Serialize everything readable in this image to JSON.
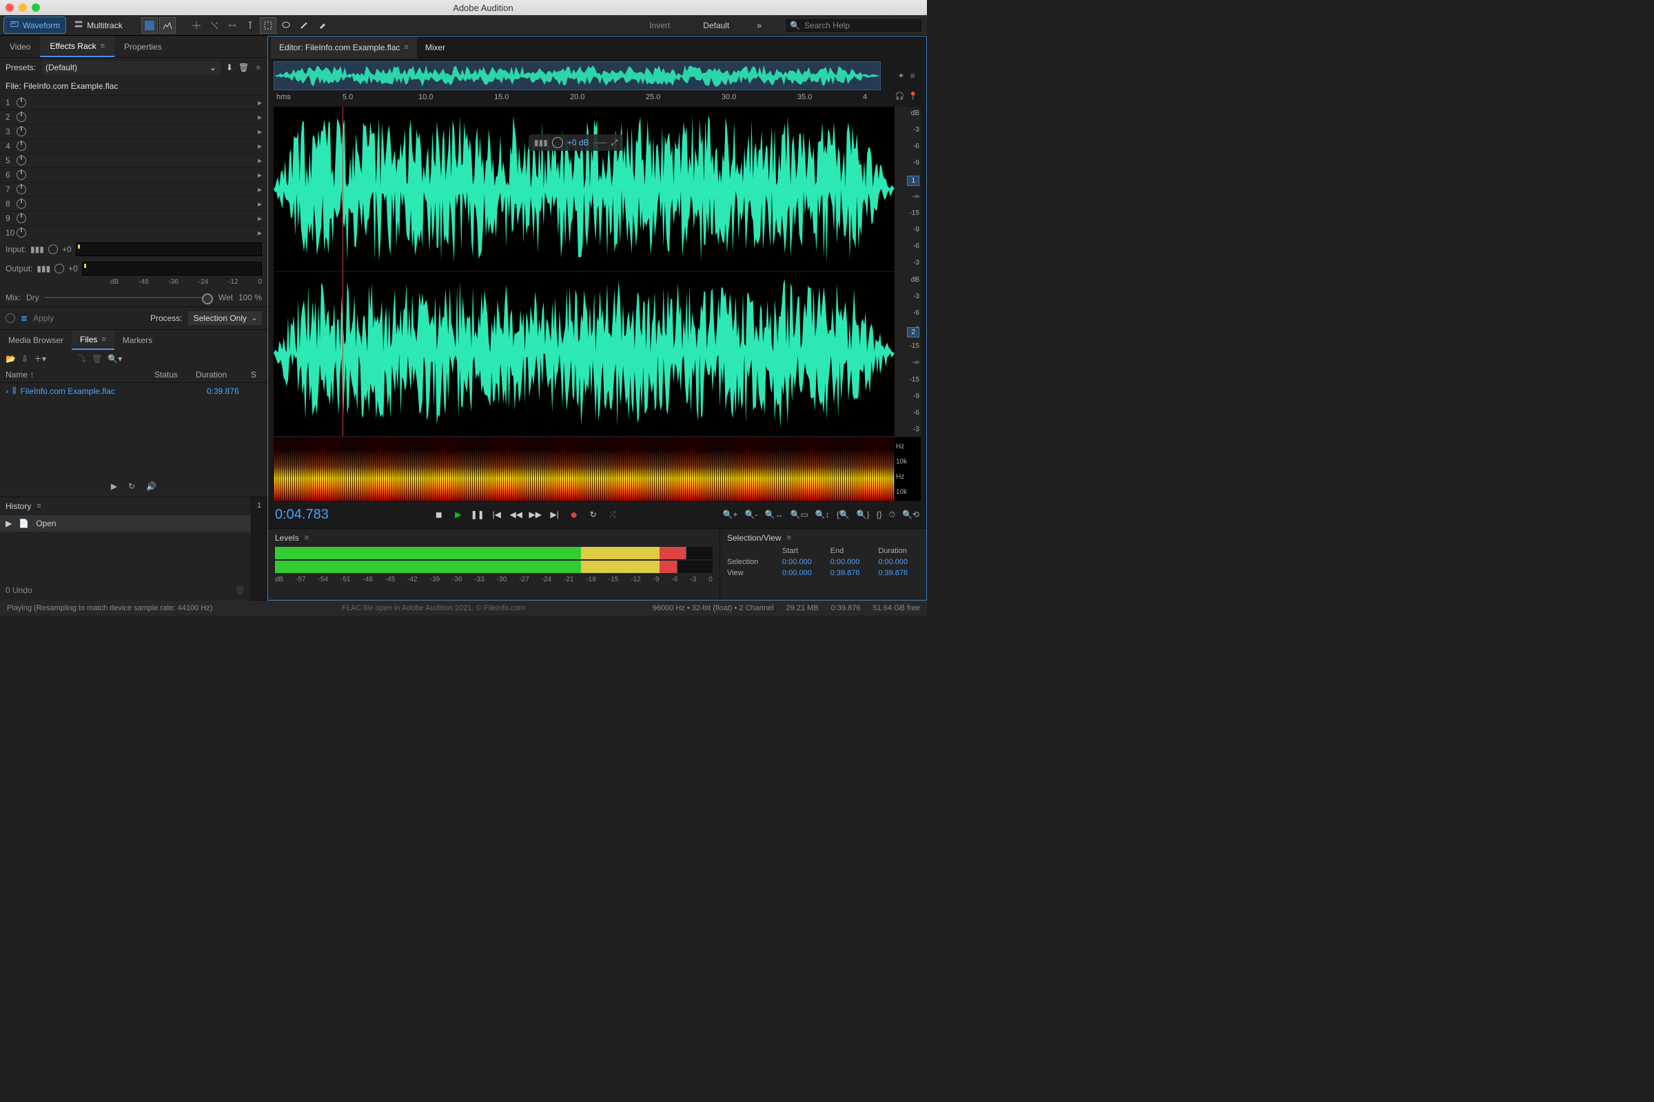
{
  "app": {
    "title": "Adobe Audition"
  },
  "topbar": {
    "waveform": "Waveform",
    "multitrack": "Multitrack",
    "invert": "Invert",
    "workspace": "Default",
    "search_placeholder": "Search Help"
  },
  "left_tabs": {
    "video": "Video",
    "effects_rack": "Effects Rack",
    "properties": "Properties"
  },
  "effects": {
    "presets_label": "Presets:",
    "preset_value": "(Default)",
    "file_label": "File: FileInfo.com Example.flac",
    "slot_count": "10",
    "input_label": "Input:",
    "output_label": "Output:",
    "io_db": "+0",
    "db_scale": [
      "dB",
      "-48",
      "-36",
      "-24",
      "-12",
      "0"
    ],
    "mix_label": "Mix:",
    "dry": "Dry",
    "wet": "Wet",
    "mix_pct": "100 %",
    "apply": "Apply",
    "process_label": "Process:",
    "process_value": "Selection Only"
  },
  "files_tabs": {
    "media_browser": "Media Browser",
    "files": "Files",
    "markers": "Markers"
  },
  "files": {
    "cols": {
      "name": "Name",
      "status": "Status",
      "duration": "Duration",
      "s": "S"
    },
    "row": {
      "name": "FileInfo.com Example.flac",
      "duration": "0:39.876"
    }
  },
  "history": {
    "title": "History",
    "open": "Open",
    "undo": "0 Undo",
    "badge": "1"
  },
  "editor": {
    "tab_label": "Editor: FileInfo.com Example.flac",
    "mixer": "Mixer",
    "hms": "hms",
    "ticks": [
      "5.0",
      "10.0",
      "15.0",
      "20.0",
      "25.0",
      "30.0",
      "35.0",
      "4"
    ],
    "db_label": "dB",
    "db_marks": [
      "-3",
      "-6",
      "-9",
      "-15",
      "-∞",
      "-15",
      "-9",
      "-6",
      "-3"
    ],
    "ch1": "1",
    "ch2": "2",
    "hz": "Hz",
    "hz10k": "10k",
    "hud_db": "+0 dB",
    "time": "0:04.783"
  },
  "levels": {
    "title": "Levels",
    "scale": [
      "dB",
      "-57",
      "-54",
      "-51",
      "-48",
      "-45",
      "-42",
      "-39",
      "-36",
      "-33",
      "-30",
      "-27",
      "-24",
      "-21",
      "-18",
      "-15",
      "-12",
      "-9",
      "-6",
      "-3",
      "0"
    ]
  },
  "selview": {
    "title": "Selection/View",
    "cols": [
      "Start",
      "End",
      "Duration"
    ],
    "rows": {
      "selection": {
        "label": "Selection",
        "start": "0:00.000",
        "end": "0:00.000",
        "dur": "0:00.000"
      },
      "view": {
        "label": "View",
        "start": "0:00.000",
        "end": "0:39.876",
        "dur": "0:39.876"
      }
    }
  },
  "status": {
    "playing": "Playing (Resampling to match device sample rate: 44100 Hz)",
    "caption": ".FLAC file open in Adobe Audition 2021. © FileInfo.com",
    "format": "96000 Hz • 32-bit (float) • 2 Channel",
    "size": "29.21 MB",
    "dur": "0:39.876",
    "free": "51.64 GB free"
  }
}
